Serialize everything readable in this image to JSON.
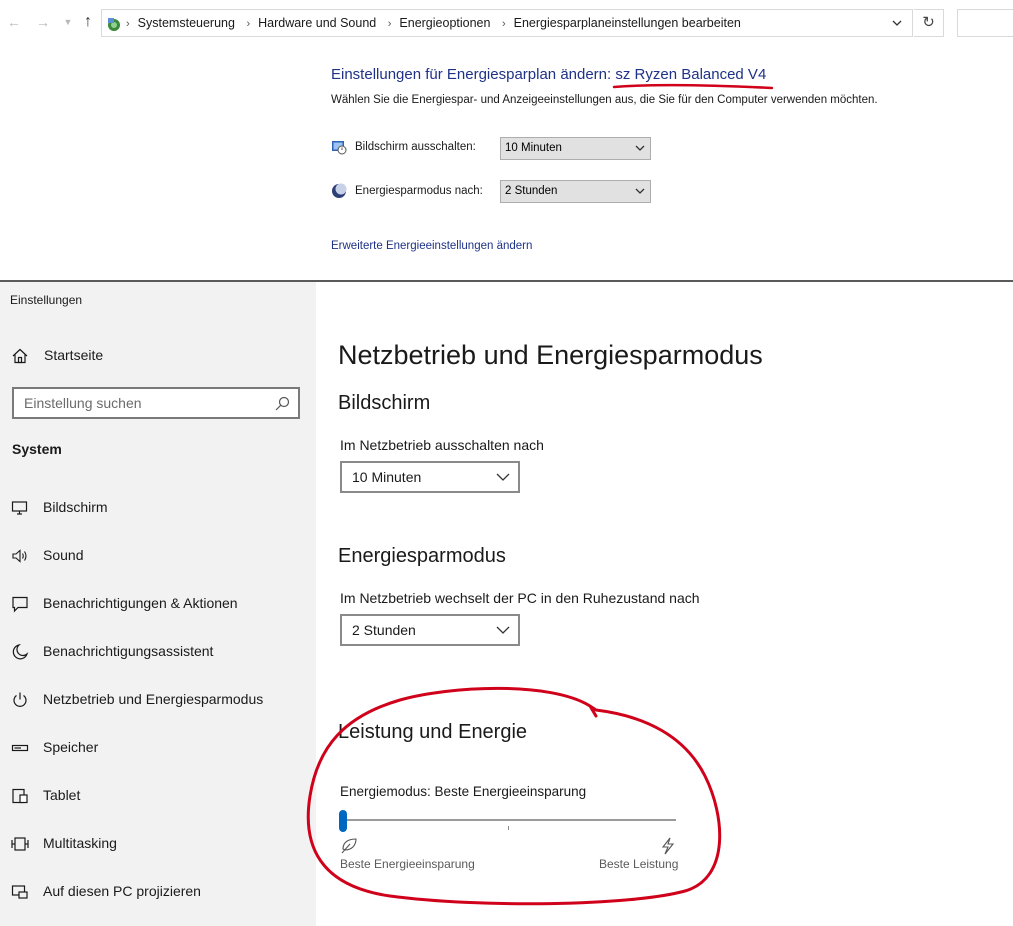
{
  "control_panel": {
    "breadcrumb": [
      "Systemsteuerung",
      "Hardware und Sound",
      "Energieoptionen",
      "Energiesparplaneinstellungen bearbeiten"
    ],
    "title_prefix": "Einstellungen für Energiesparplan ändern",
    "plan_name": ": sz Ryzen Balanced V4",
    "description": "Wählen Sie die Energiespar- und Anzeigeeinstellungen aus, die Sie für den Computer verwenden möchten.",
    "display_off_label": "Bildschirm ausschalten:",
    "display_off_value": "10 Minuten",
    "sleep_label": "Energiesparmodus nach:",
    "sleep_value": "2 Stunden",
    "advanced_link": "Erweiterte Energieeinstellungen ändern",
    "annotation_color": "#d0021b",
    "link_color": "#1e3287"
  },
  "settings": {
    "app_title": "Einstellungen",
    "home_label": "Startseite",
    "search_placeholder": "Einstellung suchen",
    "section_label": "System",
    "nav": [
      {
        "label": "Bildschirm",
        "icon": "monitor-icon"
      },
      {
        "label": "Sound",
        "icon": "speaker-icon"
      },
      {
        "label": "Benachrichtigungen & Aktionen",
        "icon": "notification-icon"
      },
      {
        "label": "Benachrichtigungsassistent",
        "icon": "moon-icon"
      },
      {
        "label": "Netzbetrieb und Energiesparmodus",
        "icon": "power-icon"
      },
      {
        "label": "Speicher",
        "icon": "storage-icon"
      },
      {
        "label": "Tablet",
        "icon": "tablet-icon"
      },
      {
        "label": "Multitasking",
        "icon": "multitasking-icon"
      },
      {
        "label": "Auf diesen PC projizieren",
        "icon": "project-icon"
      }
    ],
    "page_title": "Netzbetrieb und Energiesparmodus",
    "screen": {
      "heading": "Bildschirm",
      "label": "Im Netzbetrieb ausschalten nach",
      "value": "10 Minuten"
    },
    "sleep": {
      "heading": "Energiesparmodus",
      "label": "Im Netzbetrieb wechselt der PC in den Ruhezustand nach",
      "value": "2 Stunden"
    },
    "power": {
      "heading": "Leistung und Energie",
      "mode_label": "Energiemodus: Beste Energieeinsparung",
      "slider_value": 0,
      "slider_min_label": "Beste Energieeinsparung",
      "slider_max_label": "Beste Leistung",
      "accent_color": "#0067c0"
    }
  }
}
